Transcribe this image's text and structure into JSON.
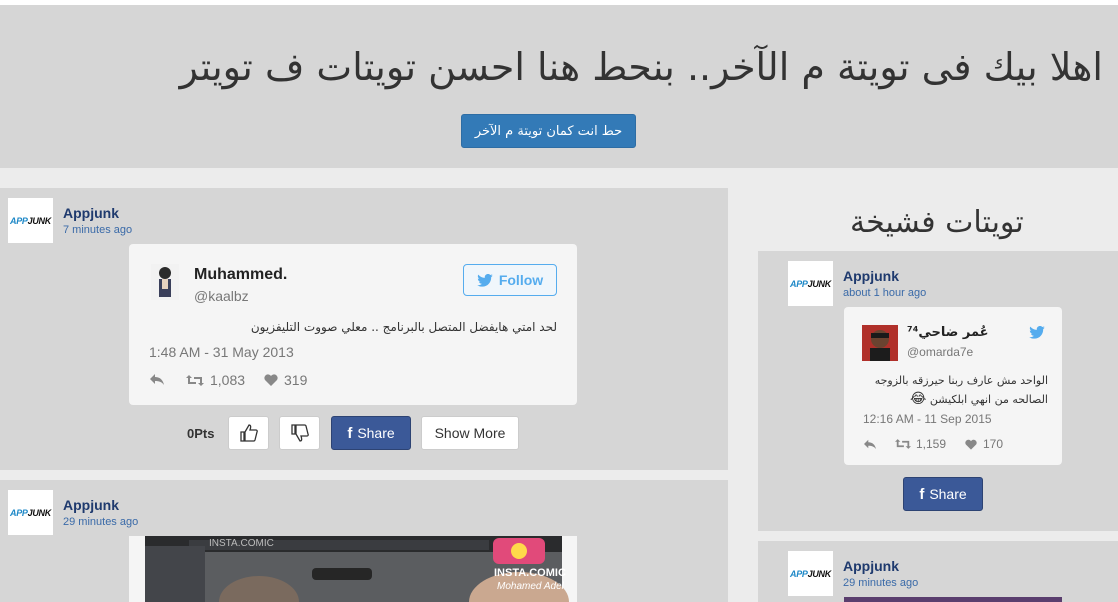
{
  "hero": {
    "title": "اهلا بيك فى تويتة م الآخر.. بنحط هنا احسن تويتات ف تويتر",
    "button_label": "حط انت كمان تويتة م الآخر"
  },
  "logo": {
    "part1": "APP",
    "part2": "JUNK"
  },
  "main_posts": [
    {
      "author": "Appjunk",
      "time": "7 minutes ago",
      "tweet": {
        "name": "Muhammed.",
        "handle": "@kaalbz",
        "follow_label": "Follow",
        "text": "لحد امتي هايفضل المتصل بالبرنامج .. معلي صووت التليفزيون",
        "date": "1:48 AM - 31 May 2013",
        "retweets": "1,083",
        "likes": "319"
      },
      "points": "0Pts",
      "share_label": "Share",
      "show_more_label": "Show More"
    },
    {
      "author": "Appjunk",
      "time": "29 minutes ago",
      "image_watermark": "INSTA.COMIC",
      "image_credit": "Mohamed Adel"
    }
  ],
  "sidebar": {
    "title": "تويتات فشيخة",
    "posts": [
      {
        "author": "Appjunk",
        "time": "about 1 hour ago",
        "tweet": {
          "name": "عُمر ضاحي⁷⁴",
          "handle": "@omarda7e",
          "text": "الواحد مش عارف ربنا حيرزقه بالزوجه الصالحه من انهي ابلكيشن",
          "emoji": "😂",
          "date": "12:16 AM - 11 Sep 2015",
          "retweets": "1,159",
          "likes": "170"
        },
        "share_label": "Share"
      },
      {
        "author": "Appjunk",
        "time": "29 minutes ago"
      }
    ]
  },
  "colors": {
    "primary": "#337ab7",
    "facebook": "#3b5998",
    "twitter": "#55acee",
    "author": "#1f3a6e",
    "time": "#3a6aa8"
  }
}
